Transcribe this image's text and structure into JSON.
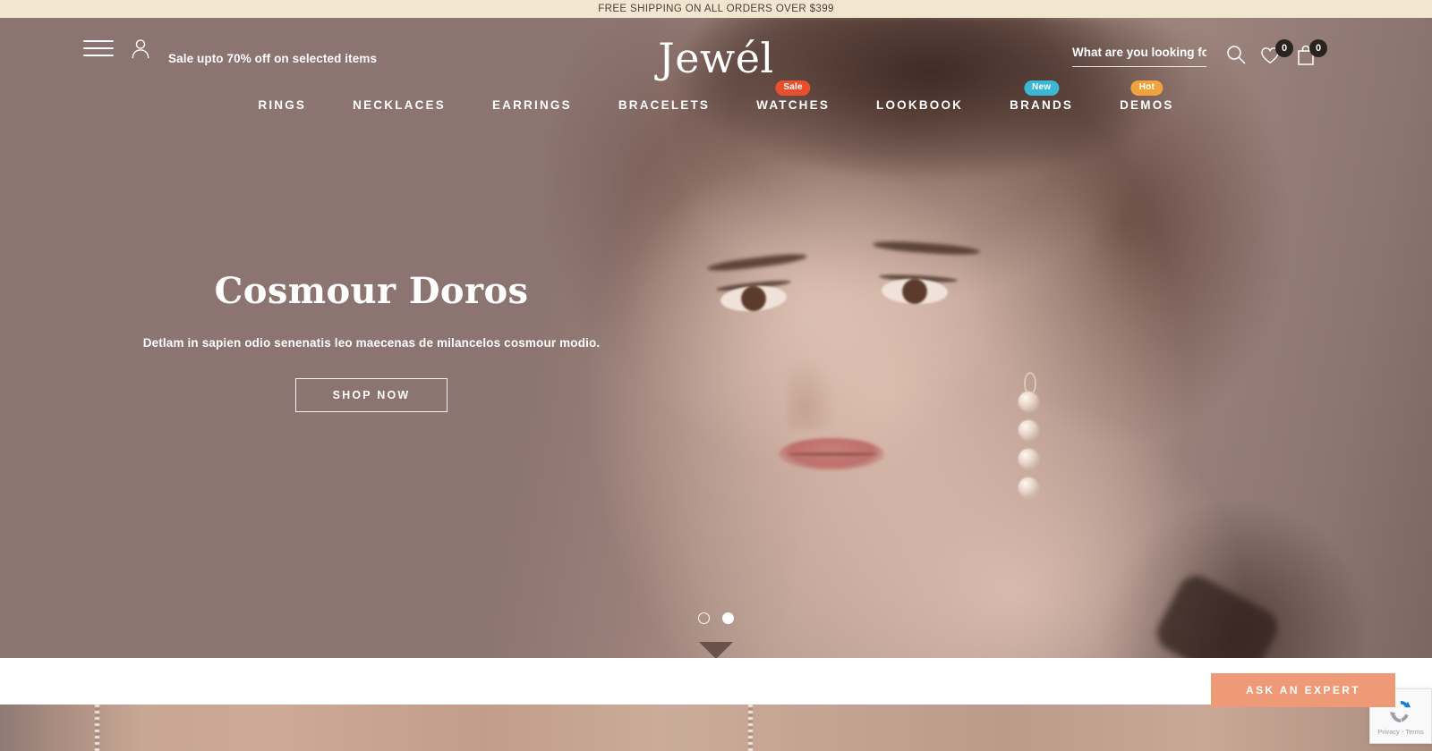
{
  "announcement": {
    "text": "FREE SHIPPING ON ALL ORDERS OVER $399"
  },
  "header": {
    "menu_icon": "hamburger-icon",
    "account_icon": "user-icon",
    "promo_text": "Sale upto 70% off on selected items",
    "logo": "Jewél",
    "search": {
      "placeholder": "What are you looking for",
      "value": "",
      "icon": "search-icon"
    },
    "wishlist": {
      "icon": "heart-icon",
      "count": "0"
    },
    "cart": {
      "icon": "shopping-bag-icon",
      "count": "0"
    }
  },
  "nav": {
    "items": [
      {
        "label": "RINGS",
        "badge": null,
        "badge_color": null
      },
      {
        "label": "NECKLACES",
        "badge": null,
        "badge_color": null
      },
      {
        "label": "EARRINGS",
        "badge": null,
        "badge_color": null
      },
      {
        "label": "BRACELETS",
        "badge": null,
        "badge_color": null
      },
      {
        "label": "WATCHES",
        "badge": "Sale",
        "badge_color": "#e8502d"
      },
      {
        "label": "LOOKBOOK",
        "badge": null,
        "badge_color": null
      },
      {
        "label": "BRANDS",
        "badge": "New",
        "badge_color": "#3bb6d4"
      },
      {
        "label": "DEMOS",
        "badge": "Hot",
        "badge_color": "#f0a33c"
      }
    ]
  },
  "hero": {
    "heading": "Cosmour Doros",
    "subheading": "Detlam in sapien odio senenatis leo maecenas de milancelos cosmour modio.",
    "cta_label": "SHOP NOW",
    "background_color": "#8c7470",
    "slides": [
      {
        "active": true
      },
      {
        "active": false
      }
    ]
  },
  "floating": {
    "ask_expert_label": "ASK AN EXPERT",
    "ask_expert_color": "#ef9a77",
    "recaptcha_text": "Privacy - Terms",
    "recaptcha_icon": "recaptcha-icon"
  }
}
